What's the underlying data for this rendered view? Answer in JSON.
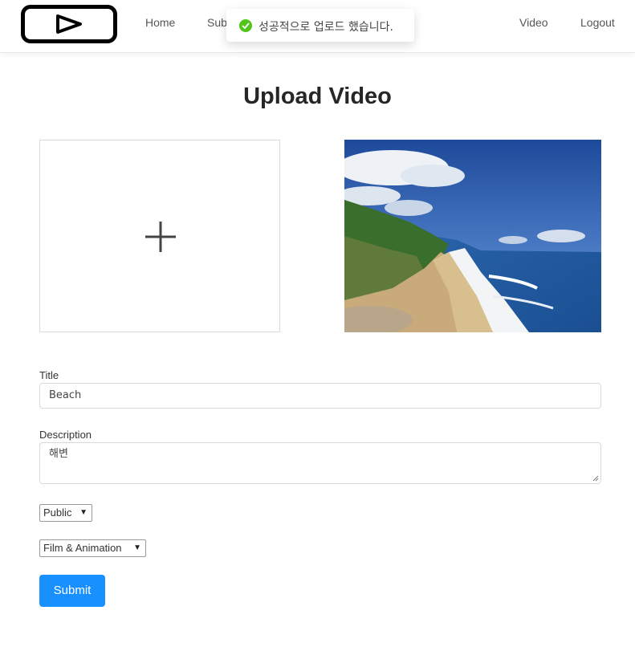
{
  "nav": {
    "logo": "play-logo",
    "items": [
      {
        "label": "Home"
      },
      {
        "label": "Sub"
      },
      {
        "label": "Video"
      },
      {
        "label": "Logout"
      }
    ]
  },
  "toast": {
    "icon": "check-circle-icon",
    "message": "성공적으로 업로드 했습니다."
  },
  "page": {
    "title": "Upload Video"
  },
  "dropzone": {
    "icon": "plus-icon"
  },
  "thumbnail": {
    "alt": "beach thumbnail"
  },
  "form": {
    "title_label": "Title",
    "title_value": "Beach",
    "description_label": "Description",
    "description_value": "해변",
    "privacy_selected": "Public",
    "category_selected": "Film & Animation",
    "submit_label": "Submit"
  },
  "colors": {
    "accent": "#1890ff",
    "success": "#52c41a"
  }
}
